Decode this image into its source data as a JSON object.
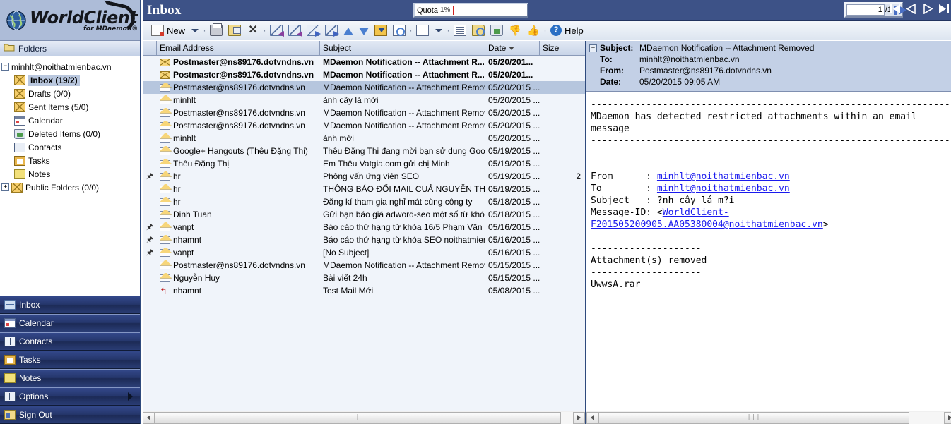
{
  "brand": {
    "name": "WorldClient",
    "tagline": "for MDaemon®"
  },
  "sidebar": {
    "folders_header": "Folders",
    "account": "minhlt@noithatmienbac.vn",
    "folders": [
      {
        "label": "Inbox (19/2)",
        "icon": "envelope-icon",
        "selected": true
      },
      {
        "label": "Drafts (0/0)",
        "icon": "envelope-icon",
        "selected": false
      },
      {
        "label": "Sent Items (5/0)",
        "icon": "envelope-icon",
        "selected": false
      },
      {
        "label": "Calendar",
        "icon": "calendar-icon",
        "selected": false
      },
      {
        "label": "Deleted Items (0/0)",
        "icon": "trash-icon",
        "selected": false
      },
      {
        "label": "Contacts",
        "icon": "contacts-icon",
        "selected": false
      },
      {
        "label": "Tasks",
        "icon": "tasks-icon",
        "selected": false
      },
      {
        "label": "Notes",
        "icon": "notes-icon",
        "selected": false
      }
    ],
    "public_folders": "Public Folders (0/0)",
    "nav_buttons": [
      {
        "label": "Inbox",
        "icon": "inbox-icon"
      },
      {
        "label": "Calendar",
        "icon": "calendar-icon"
      },
      {
        "label": "Contacts",
        "icon": "contacts-icon"
      },
      {
        "label": "Tasks",
        "icon": "tasks-icon"
      },
      {
        "label": "Notes",
        "icon": "notes-icon"
      },
      {
        "label": "Options",
        "icon": "options-icon"
      },
      {
        "label": "Sign Out",
        "icon": "signout-icon"
      }
    ]
  },
  "header": {
    "title": "Inbox",
    "quota_label": "Quota",
    "quota_percent": "1%",
    "page_current": "1",
    "page_total": "/1"
  },
  "toolbar": {
    "new_label": "New",
    "help_label": "Help",
    "icons": [
      "new-message-icon",
      "dropdown-caret-icon",
      "print-icon",
      "move-icon",
      "delete-icon",
      "reply-icon",
      "reply-all-icon",
      "forward-icon",
      "forward-attachment-icon",
      "move-up-icon",
      "move-down-icon",
      "move-to-inbox-icon",
      "view-source-icon",
      "columns-icon",
      "columns-caret-icon",
      "message-rules-icon",
      "search-folder-icon",
      "empty-trash-icon",
      "block-sender-icon",
      "allow-sender-icon",
      "help-icon"
    ]
  },
  "message_list": {
    "columns": [
      "Email Address",
      "Subject",
      "Date",
      "Size"
    ],
    "sort_column": "Date",
    "sort_direction": "desc",
    "rows": [
      {
        "flag": "",
        "mail_icon": "envelope-closed-icon",
        "from": "Postmaster@ns89176.dotvndns.vn",
        "subject": "MDaemon Notification -- Attachment R...",
        "date": "05/20/201...",
        "size": "",
        "unread": true,
        "selected": false
      },
      {
        "flag": "",
        "mail_icon": "envelope-closed-icon",
        "from": "Postmaster@ns89176.dotvndns.vn",
        "subject": "MDaemon Notification -- Attachment R...",
        "date": "05/20/201...",
        "size": "",
        "unread": true,
        "selected": false
      },
      {
        "flag": "",
        "mail_icon": "envelope-open-icon",
        "from": "Postmaster@ns89176.dotvndns.vn",
        "subject": "MDaemon Notification -- Attachment Removed",
        "date": "05/20/2015 ...",
        "size": "",
        "unread": false,
        "selected": true
      },
      {
        "flag": "",
        "mail_icon": "envelope-open-icon",
        "from": "minhlt",
        "subject": "ảnh cây lá mới",
        "date": "05/20/2015 ...",
        "size": "",
        "unread": false,
        "selected": false
      },
      {
        "flag": "",
        "mail_icon": "envelope-open-icon",
        "from": "Postmaster@ns89176.dotvndns.vn",
        "subject": "MDaemon Notification -- Attachment Removed",
        "date": "05/20/2015 ...",
        "size": "",
        "unread": false,
        "selected": false
      },
      {
        "flag": "",
        "mail_icon": "envelope-open-icon",
        "from": "Postmaster@ns89176.dotvndns.vn",
        "subject": "MDaemon Notification -- Attachment Removed",
        "date": "05/20/2015 ...",
        "size": "",
        "unread": false,
        "selected": false
      },
      {
        "flag": "",
        "mail_icon": "envelope-open-icon",
        "from": "minhlt",
        "subject": "ảnh mới",
        "date": "05/20/2015 ...",
        "size": "",
        "unread": false,
        "selected": false
      },
      {
        "flag": "",
        "mail_icon": "envelope-open-icon",
        "from": "Google+ Hangouts (Thêu Đặng Thị)",
        "subject": "Thêu Đặng Thị đang mời bạn sử dụng Google...",
        "date": "05/19/2015 ...",
        "size": "",
        "unread": false,
        "selected": false
      },
      {
        "flag": "",
        "mail_icon": "envelope-open-icon",
        "from": "Thêu Đặng Thị",
        "subject": "Em Thêu Vatgia.com gửi chị Minh",
        "date": "05/19/2015 ...",
        "size": "",
        "unread": false,
        "selected": false
      },
      {
        "flag": "attachment-icon",
        "mail_icon": "envelope-open-icon",
        "from": "hr",
        "subject": "Phỏng vấn ứng viên SEO",
        "date": "05/19/2015 ...",
        "size": "2",
        "unread": false,
        "selected": false
      },
      {
        "flag": "",
        "mail_icon": "envelope-open-icon",
        "from": "hr",
        "subject": "THÔNG BÁO ĐỔI MAIL CUẢ NGUYỄN THỦY D...",
        "date": "05/19/2015 ...",
        "size": "",
        "unread": false,
        "selected": false
      },
      {
        "flag": "",
        "mail_icon": "envelope-open-icon",
        "from": "hr",
        "subject": "Đăng kí tham gia nghỉ mát cùng công ty",
        "date": "05/18/2015 ...",
        "size": "",
        "unread": false,
        "selected": false
      },
      {
        "flag": "",
        "mail_icon": "envelope-open-icon",
        "from": "Dinh Tuan",
        "subject": "Gửi bạn báo giá adword-seo một số từ khóa đ...",
        "date": "05/18/2015 ...",
        "size": "",
        "unread": false,
        "selected": false
      },
      {
        "flag": "attachment-icon",
        "mail_icon": "envelope-open-icon",
        "from": "vanpt",
        "subject": "Báo cáo thứ hạng từ khóa 16/5 Phạm Vân",
        "date": "05/16/2015 ...",
        "size": "",
        "unread": false,
        "selected": false
      },
      {
        "flag": "attachment-icon",
        "mail_icon": "envelope-open-icon",
        "from": "nhamnt",
        "subject": "Báo cáo thứ hạng từ khóa SEO noithatmienba...",
        "date": "05/16/2015 ...",
        "size": "",
        "unread": false,
        "selected": false
      },
      {
        "flag": "attachment-icon",
        "mail_icon": "envelope-open-icon",
        "from": "vanpt",
        "subject": "[No Subject]",
        "date": "05/16/2015 ...",
        "size": "",
        "unread": false,
        "selected": false
      },
      {
        "flag": "",
        "mail_icon": "envelope-open-icon",
        "from": "Postmaster@ns89176.dotvndns.vn",
        "subject": "MDaemon Notification -- Attachment Removed",
        "date": "05/15/2015 ...",
        "size": "",
        "unread": false,
        "selected": false
      },
      {
        "flag": "",
        "mail_icon": "envelope-open-icon",
        "from": "Nguyễn Huy",
        "subject": "Bài viết 24h",
        "date": "05/15/2015 ...",
        "size": "",
        "unread": false,
        "selected": false
      },
      {
        "flag": "",
        "mail_icon": "envelope-replied-icon",
        "from": "nhamnt",
        "subject": "Test Mail Mới",
        "date": "05/08/2015 ...",
        "size": "",
        "unread": false,
        "selected": false
      }
    ]
  },
  "preview": {
    "labels": {
      "subject": "Subject:",
      "to": "To:",
      "from": "From:",
      "date": "Date:"
    },
    "subject": "MDaemon Notification -- Attachment Removed",
    "to": "minhlt@noithatmienbac.vn",
    "from": "Postmaster@ns89176.dotvndns.vn",
    "date": "05/20/2015 09:05 AM",
    "body_lines": [
      {
        "text": "------------------------------------------------------------------",
        "type": "plain"
      },
      {
        "text": "MDaemon has detected restricted attachments within an email",
        "type": "plain"
      },
      {
        "text": "message",
        "type": "plain"
      },
      {
        "text": "------------------------------------------------------------------",
        "type": "plain"
      },
      {
        "text": "",
        "type": "plain"
      },
      {
        "text": "",
        "type": "plain"
      },
      {
        "text": "From      : ",
        "type": "plain",
        "link": "minhlt@noithatmienbac.vn"
      },
      {
        "text": "To        : ",
        "type": "plain",
        "link": "minhlt@noithatmienbac.vn"
      },
      {
        "text": "Subject   : ?nh cây lá m?i",
        "type": "plain"
      },
      {
        "text": "Message-ID: <",
        "type": "plain",
        "link": "WorldClient-"
      },
      {
        "text": "",
        "type": "plain",
        "link": "F201505200905.AA05380004@noithatmienbac.vn",
        "suffix": ">"
      },
      {
        "text": "",
        "type": "plain"
      },
      {
        "text": "--------------------",
        "type": "plain"
      },
      {
        "text": "Attachment(s) removed",
        "type": "plain"
      },
      {
        "text": "--------------------",
        "type": "plain"
      },
      {
        "text": "UwwsA.rar",
        "type": "plain"
      }
    ]
  },
  "colors": {
    "titlebar": "#3d5287",
    "sidebar_nav": "#25366b",
    "selection": "#b6c6de",
    "header_panel": "#c3d0e6",
    "link": "#1a1aee",
    "quota_bar": "#d02020"
  }
}
